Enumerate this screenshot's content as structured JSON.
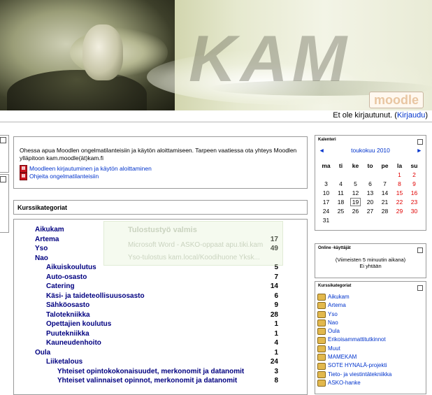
{
  "banner": {
    "logo_text": "KAM",
    "moodle_text": "moodle"
  },
  "login": {
    "text": "Et ole kirjautunut. (",
    "link": "Kirjaudu",
    "close": ")"
  },
  "info": {
    "text": "Ohessa apua Moodlen ongelmatilanteisiin ja käytön aloittamiseen. Tarpeen vaatiessa ota yhteys Moodlen ylläpitoon kam.moodle(ät)kam.fi",
    "links": [
      "Moodleen kirjautuminen ja käytön aloittaminen",
      "Ohjeita ongelmatilanteisiin"
    ]
  },
  "categories": {
    "title": "Kurssikategoriat",
    "items": [
      {
        "name": "Aikukam",
        "count": ""
      },
      {
        "name": "Artema",
        "count": "17"
      },
      {
        "name": "Yso",
        "count": "49"
      },
      {
        "name": "Nao",
        "count": ""
      },
      {
        "name": "Aikuiskoulutus",
        "count": "5"
      },
      {
        "name": "Auto-osasto",
        "count": "7"
      },
      {
        "name": "Catering",
        "count": "14"
      },
      {
        "name": "Käsi- ja taideteollisuusosasto",
        "count": "6"
      },
      {
        "name": "Sähköosasto",
        "count": "9"
      },
      {
        "name": "Talotekniikka",
        "count": "28"
      },
      {
        "name": "Opettajien koulutus",
        "count": "1"
      },
      {
        "name": "Puutekniikka",
        "count": "1"
      },
      {
        "name": "Kauneudenhoito",
        "count": "4"
      },
      {
        "name": "Oula",
        "count": "1"
      },
      {
        "name": "Liiketalous",
        "count": "24"
      },
      {
        "name": "Yhteiset opintokokonaisuudet, merkonomit ja datanomit",
        "count": "3"
      },
      {
        "name": "Yhteiset valinnaiset opinnot, merkonomit ja datanomit",
        "count": "8"
      }
    ]
  },
  "toast": {
    "title": "Tulostustyö valmis",
    "line1": "Microsoft Word - ASKO-oppaat apu.tiki.kam",
    "line2": "Yso-tulostus kam.local/Koodihuone Yksk..."
  },
  "calendar": {
    "title": "Kalenteri",
    "prev": "◄",
    "next": "►",
    "month": "toukokuu 2010",
    "weekdays": [
      "ma",
      "ti",
      "ke",
      "to",
      "pe",
      "la",
      "su"
    ],
    "weeks": [
      [
        "",
        "",
        "",
        "",
        "",
        "1",
        "2"
      ],
      [
        "3",
        "4",
        "5",
        "6",
        "7",
        "8",
        "9"
      ],
      [
        "10",
        "11",
        "12",
        "13",
        "14",
        "15",
        "16"
      ],
      [
        "17",
        "18",
        "19",
        "20",
        "21",
        "22",
        "23"
      ],
      [
        "24",
        "25",
        "26",
        "27",
        "28",
        "29",
        "30"
      ],
      [
        "31",
        "",
        "",
        "",
        "",
        "",
        ""
      ]
    ],
    "today": "19",
    "weekend_color": "#e00000"
  },
  "online": {
    "title": "Online -käyttäjät",
    "line1": "(Viimeisten 5 minuutin aikana)",
    "line2": "Ei yhtään"
  },
  "right_categories": {
    "title": "Kurssikategoriat",
    "items": [
      "Aikukam",
      "Artema",
      "Yso",
      "Nao",
      "Oula",
      "Erikoisammattitutkinnot",
      "Muut",
      "MAMEKAM",
      "SOTE HYNALÄ-projekti",
      "Tieto- ja viestintätekniikka",
      "ASKO-hanke"
    ]
  },
  "colors": {
    "link": "#0033cc",
    "category": "#000080",
    "weekend": "#e00000"
  }
}
